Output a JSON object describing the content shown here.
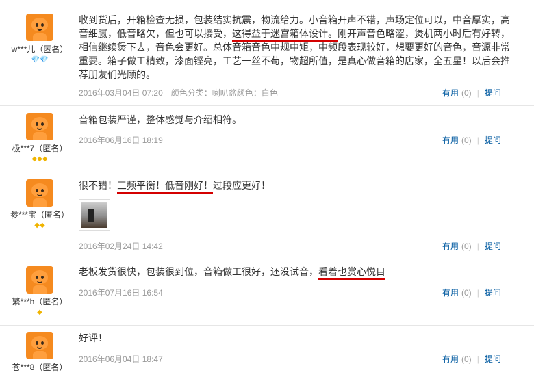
{
  "reviews": [
    {
      "user": "w***儿（匿名）",
      "badge": "💎💎",
      "content_parts": [
        "收到货后，开箱检查无损，包装结实抗震，物流给力。小音箱开声不错，声场定位可以，中音厚实，高音细腻，低音略欠，但也可以接受，",
        "这得益于迷宫箱体设计。",
        "刚开声音色略涩，煲机两小时后有好转，相信继续煲下去，音色会更好。总体音箱音色中规中矩，中频段表现较好，想要更好的音色，音源非常重要。箱子做工精致，漆面铿亮，工艺一丝不苟，物超所值，是真心做音箱的店家，全五星！以后会推荐朋友们光顾的。"
      ],
      "date": "2016年03月04日 07:20",
      "spec": "颜色分类：喇叭盆颜色：白色",
      "useful": "有用",
      "count": "(0)",
      "ask": "提问"
    },
    {
      "user": "极***7（匿名）",
      "badge": "◆◆◆",
      "content_parts": [
        "音箱包装严谨，整体感觉与介绍相符。"
      ],
      "date": "2016年06月16日 18:19",
      "useful": "有用",
      "count": "(0)",
      "ask": "提问"
    },
    {
      "user": "参***宝（匿名）",
      "badge": "◆◆",
      "content_parts": [
        "很不错！",
        "三频平衡！低音刚好！",
        "过段应更好！"
      ],
      "date": "2016年02月24日 14:42",
      "useful": "有用",
      "count": "(0)",
      "ask": "提问"
    },
    {
      "user": "繁***h（匿名）",
      "badge": "◆",
      "content_parts": [
        "老板发货很快，包装很到位，音箱做工很好，还没试音，",
        "看着也赏心悦目"
      ],
      "date": "2016年07月16日 16:54",
      "useful": "有用",
      "count": "(0)",
      "ask": "提问"
    },
    {
      "user": "苍***8（匿名）",
      "badge": "",
      "content_parts": [
        "好评！"
      ],
      "date": "2016年06月04日 18:47",
      "useful": "有用",
      "count": "(0)",
      "ask": "提问"
    }
  ]
}
